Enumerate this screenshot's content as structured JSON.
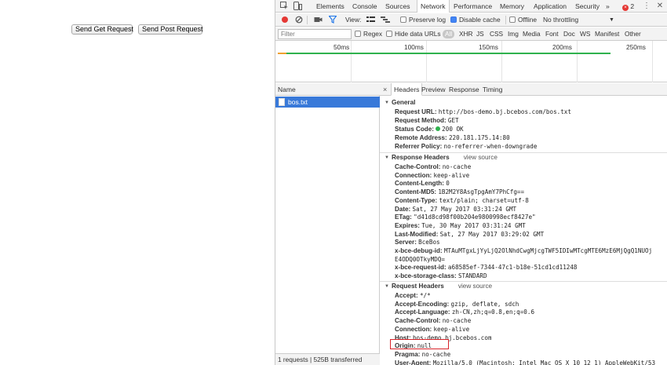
{
  "page": {
    "get_button": "Send Get Request",
    "post_button": "Send Post Request"
  },
  "devtools": {
    "tabs": [
      "Elements",
      "Console",
      "Sources",
      "Network",
      "Performance",
      "Memory",
      "Application",
      "Security"
    ],
    "active_tab": "Network",
    "more_tabs": "»",
    "error_count": "2",
    "toolbar": {
      "view_label": "View:",
      "preserve_log": "Preserve log",
      "disable_cache": "Disable cache",
      "offline": "Offline",
      "throttling": "No throttling"
    },
    "filterbar": {
      "placeholder": "Filter",
      "regex": "Regex",
      "hide_data_urls": "Hide data URLs",
      "types": [
        "All",
        "XHR",
        "JS",
        "CSS",
        "Img",
        "Media",
        "Font",
        "Doc",
        "WS",
        "Manifest",
        "Other"
      ]
    },
    "timeline": {
      "ticks": [
        "50ms",
        "100ms",
        "150ms",
        "200ms",
        "250ms"
      ]
    },
    "requests": {
      "column_name": "Name",
      "items": [
        {
          "name": "bos.txt"
        }
      ],
      "summary": "1 requests | 525B transferred"
    },
    "details": {
      "tabs": [
        "Headers",
        "Preview",
        "Response",
        "Timing"
      ],
      "active_tab": "Headers",
      "close": "×",
      "general": {
        "title": "General",
        "request_url_k": "Request URL:",
        "request_url_v": "http://bos-demo.bj.bcebos.com/bos.txt",
        "method_k": "Request Method:",
        "method_v": "GET",
        "status_k": "Status Code:",
        "status_v": "200 OK",
        "remote_k": "Remote Address:",
        "remote_v": "220.181.175.14:80",
        "referrer_k": "Referrer Policy:",
        "referrer_v": "no-referrer-when-downgrade"
      },
      "response_headers": {
        "title": "Response Headers",
        "view_source": "view source",
        "rows": [
          {
            "k": "Cache-Control:",
            "v": "no-cache"
          },
          {
            "k": "Connection:",
            "v": "keep-alive"
          },
          {
            "k": "Content-Length:",
            "v": "0"
          },
          {
            "k": "Content-MD5:",
            "v": "1B2M2Y8AsgTpgAmY7PhCfg=="
          },
          {
            "k": "Content-Type:",
            "v": "text/plain; charset=utf-8"
          },
          {
            "k": "Date:",
            "v": "Sat, 27 May 2017 03:31:24 GMT"
          },
          {
            "k": "ETag:",
            "v": "\"d41d8cd98f00b204e9800998ecf8427e\""
          },
          {
            "k": "Expires:",
            "v": "Tue, 30 May 2017 03:31:24 GMT"
          },
          {
            "k": "Last-Modified:",
            "v": "Sat, 27 May 2017 03:29:02 GMT"
          },
          {
            "k": "Server:",
            "v": "BceBos"
          },
          {
            "k": "x-bce-debug-id:",
            "v": "MTAuMTgxLjYyLjQ2OlNhdCwgMjcgTWF5IDIwMTcgMTE6MzE6MjQgQ1NUOj"
          },
          {
            "k": "",
            "v": "E4ODQ0OTkyMDQ="
          },
          {
            "k": "x-bce-request-id:",
            "v": "a68585ef-7344-47c1-b18e-51cd1cd11248"
          },
          {
            "k": "x-bce-storage-class:",
            "v": "STANDARD"
          }
        ]
      },
      "request_headers": {
        "title": "Request Headers",
        "view_source": "view source",
        "rows": [
          {
            "k": "Accept:",
            "v": "*/*"
          },
          {
            "k": "Accept-Encoding:",
            "v": "gzip, deflate, sdch"
          },
          {
            "k": "Accept-Language:",
            "v": "zh-CN,zh;q=0.8,en;q=0.6"
          },
          {
            "k": "Cache-Control:",
            "v": "no-cache"
          },
          {
            "k": "Connection:",
            "v": "keep-alive"
          },
          {
            "k": "Host:",
            "v": "bos-demo.bj.bcebos.com"
          },
          {
            "k": "Origin:",
            "v": "null"
          },
          {
            "k": "Pragma:",
            "v": "no-cache"
          },
          {
            "k": "User-Agent:",
            "v": "Mozilla/5.0 (Macintosh; Intel Mac OS X 10_12_1) AppleWebKit/53"
          }
        ]
      }
    }
  },
  "colors": {
    "selected_row": "#3879d9",
    "record": "#e53935",
    "status_ok": "#2fb24e",
    "highlight": "#d9252b"
  }
}
